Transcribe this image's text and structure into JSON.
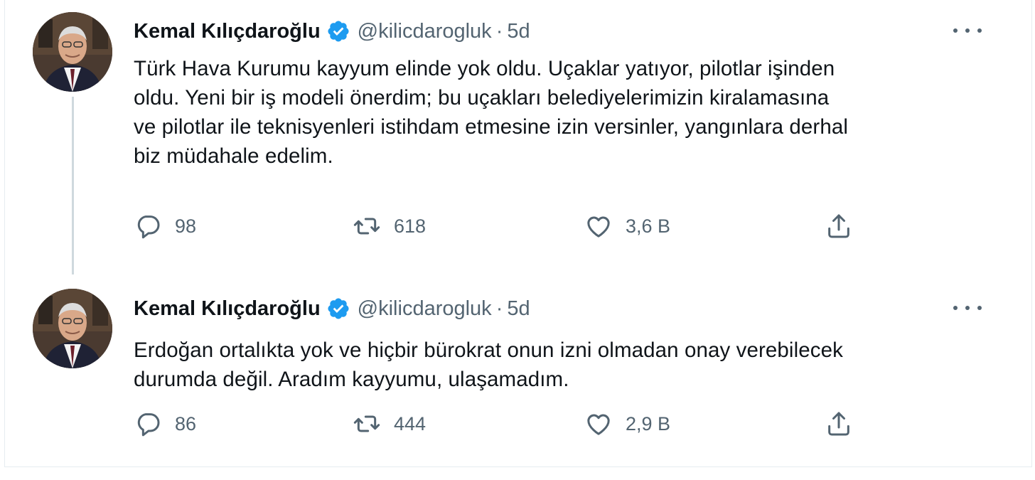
{
  "tweets": [
    {
      "author_name": "Kemal Kılıçdaroğlu",
      "handle": "@kilicdarogluk",
      "separator": "·",
      "time": "5d",
      "text_lines": [
        "Türk Hava Kurumu kayyum elinde yok oldu. Uçaklar yatıyor, pilotlar işinden",
        "oldu. Yeni bir iş modeli önerdim; bu uçakları belediyelerimizin kiralamasına",
        "ve pilotlar ile teknisyenleri istihdam etmesine izin versinler, yangınlara derhal",
        "biz müdahale edelim."
      ],
      "reply_count": "98",
      "retweet_count": "618",
      "like_count": "3,6 B"
    },
    {
      "author_name": "Kemal Kılıçdaroğlu",
      "handle": "@kilicdarogluk",
      "separator": "·",
      "time": "5d",
      "text_lines": [
        "Erdoğan ortalıkta yok ve hiçbir bürokrat onun izni olmadan onay verebilecek",
        "durumda değil. Aradım kayyumu, ulaşamadım."
      ],
      "reply_count": "86",
      "retweet_count": "444",
      "like_count": "2,9 B"
    }
  ],
  "colors": {
    "text": "#0f1419",
    "secondary": "#536471",
    "verified": "#1d9bf0",
    "thread_line": "#cfd9de"
  },
  "icons": [
    "verified-badge-icon",
    "more-icon",
    "reply-icon",
    "retweet-icon",
    "like-icon",
    "share-icon"
  ]
}
